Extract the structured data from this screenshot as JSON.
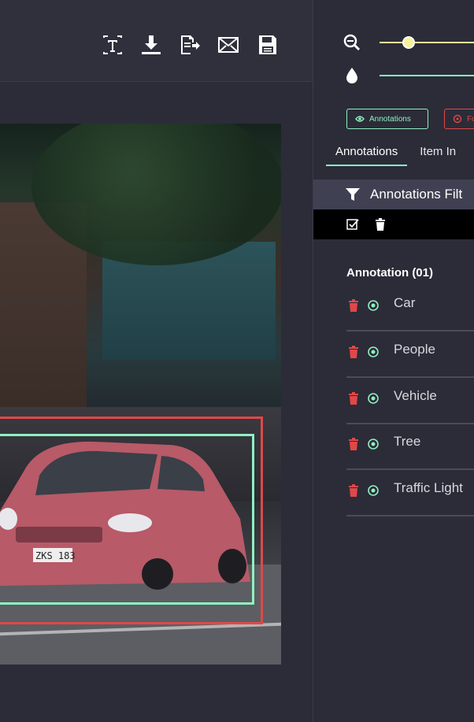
{
  "toolbar": {
    "icons": [
      "text-tool-icon",
      "download-icon",
      "export-icon",
      "email-icon",
      "save-icon"
    ]
  },
  "sliders": [
    {
      "icon": "zoom-out-icon",
      "accent": "#f7f29a",
      "value": 0.26
    },
    {
      "icon": "opacity-drop-icon",
      "accent": "#8ff0c0"
    }
  ],
  "chips": {
    "annotations": {
      "label": "Annotations",
      "color": "#8ff0c0"
    },
    "second": {
      "label": "Fo",
      "color": "#e04848"
    }
  },
  "tabs": [
    "Annotations",
    "Item In"
  ],
  "filter": {
    "label": "Annotations Filt"
  },
  "section": {
    "title": "Annotation (01)"
  },
  "annotations": [
    {
      "label": "Car"
    },
    {
      "label": "People"
    },
    {
      "label": "Vehicle"
    },
    {
      "label": "Tree"
    },
    {
      "label": "Traffic Light"
    }
  ],
  "image": {
    "plate_text": "ZKS 183",
    "boxes": [
      {
        "color": "#e04848"
      },
      {
        "color": "#8ff0c0"
      }
    ]
  }
}
